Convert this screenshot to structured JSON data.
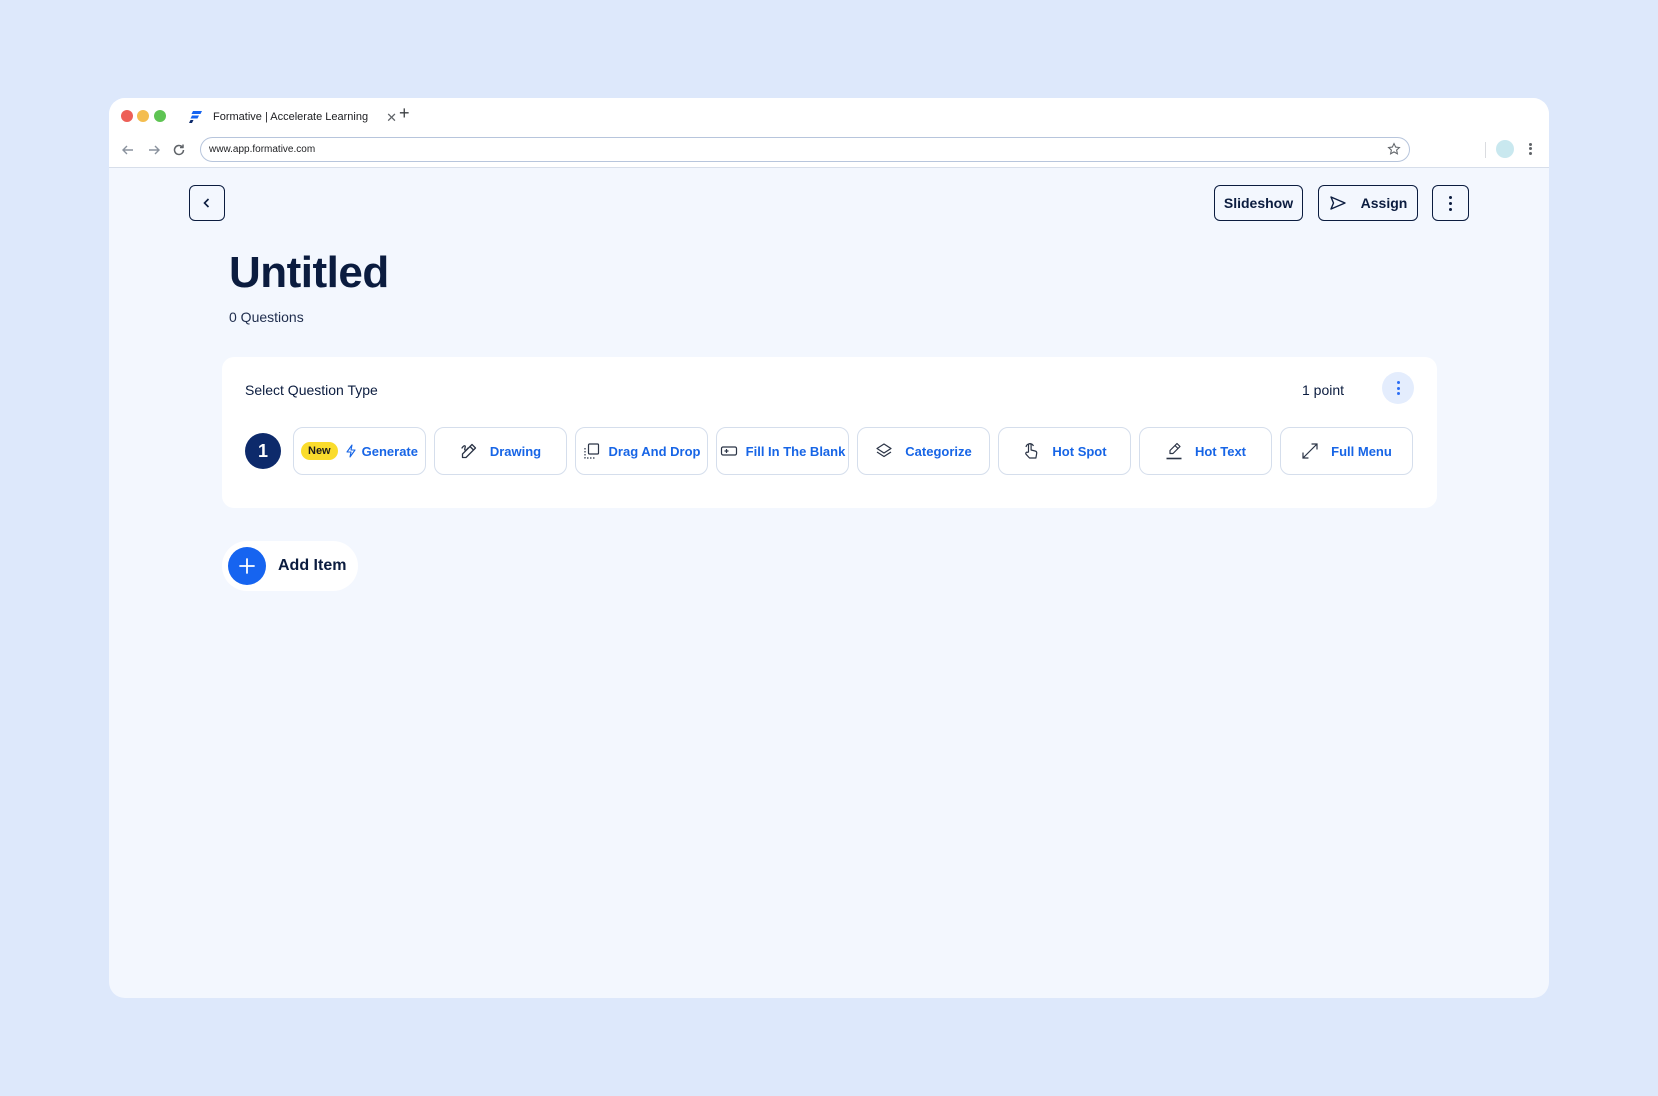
{
  "browser": {
    "tab_title": "Formative | Accelerate Learning",
    "url": "www.app.formative.com",
    "new_tab_symbol": "+",
    "close_symbol": "✕"
  },
  "header": {
    "slideshow_label": "Slideshow",
    "assign_label": "Assign"
  },
  "document": {
    "title": "Untitled",
    "subtitle": "0 Questions"
  },
  "question_card": {
    "title": "Select Question Type",
    "points": "1 point",
    "number": "1",
    "new_badge": "New",
    "types": [
      {
        "label": "Generate",
        "icon": "lightning-icon"
      },
      {
        "label": "Drawing",
        "icon": "pencil-icon"
      },
      {
        "label": "Drag And Drop",
        "icon": "drag-drop-icon"
      },
      {
        "label": "Fill In The Blank",
        "icon": "input-field-icon"
      },
      {
        "label": "Categorize",
        "icon": "layers-icon"
      },
      {
        "label": "Hot Spot",
        "icon": "pointer-hand-icon"
      },
      {
        "label": "Hot Text",
        "icon": "highlighter-icon"
      },
      {
        "label": "Full Menu",
        "icon": "expand-icon"
      }
    ]
  },
  "add_item": {
    "label": "Add Item"
  },
  "colors": {
    "page_bg": "#dde8fb",
    "app_bg": "#f3f7fe",
    "navy": "#0b1c3f",
    "accent": "#1765e6",
    "badge": "#fadc2c"
  }
}
